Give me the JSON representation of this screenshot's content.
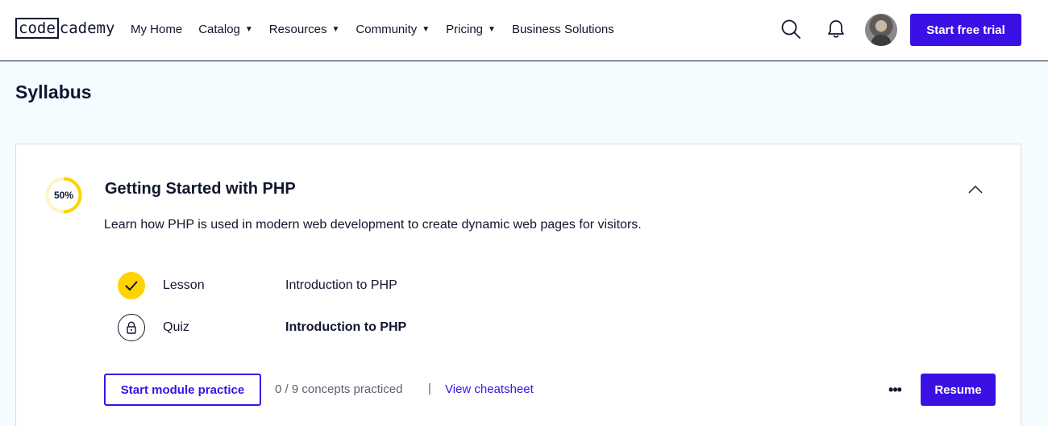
{
  "header": {
    "logo_code": "code",
    "logo_cademy": "cademy",
    "nav": [
      {
        "label": "My Home",
        "caret": ""
      },
      {
        "label": "Catalog",
        "caret": "▼"
      },
      {
        "label": "Resources",
        "caret": "▼"
      },
      {
        "label": "Community",
        "caret": "▼"
      },
      {
        "label": "Pricing",
        "caret": "▼"
      },
      {
        "label": "Business Solutions",
        "caret": ""
      }
    ],
    "search_icon": "search-icon",
    "notifications_icon": "bell-icon",
    "cta_label": "Start free trial"
  },
  "page": {
    "title": "Syllabus"
  },
  "module": {
    "progress_label": "50%",
    "progress_fraction": 0.5,
    "title": "Getting Started with PHP",
    "description": "Learn how PHP is used in modern web development to create dynamic web pages for visitors.",
    "items": [
      {
        "type": "Lesson",
        "title": "Introduction to PHP",
        "status": "completed",
        "icon": "check-icon"
      },
      {
        "type": "Quiz",
        "title": "Introduction to PHP",
        "status": "locked",
        "icon": "lock-icon"
      }
    ],
    "practice_label": "Start module practice",
    "concepts_text": "0 / 9 concepts practiced",
    "separator": "|",
    "cheatsheet_label": "View cheatsheet",
    "more_label": "•••",
    "resume_label": "Resume"
  },
  "colors": {
    "brand": "#3a10e5",
    "progress": "#ffd300",
    "text": "#10162f",
    "page_bg": "#f5fcff"
  }
}
